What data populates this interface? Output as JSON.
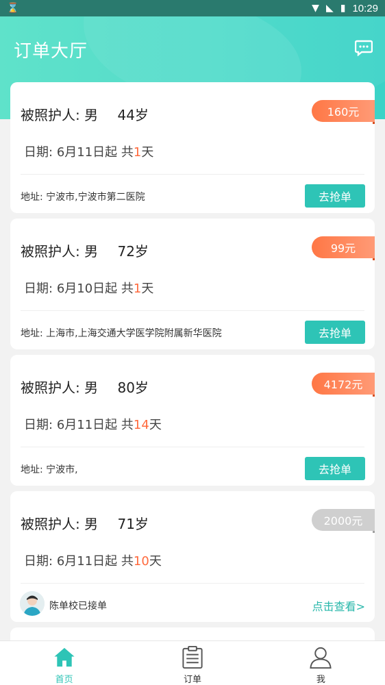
{
  "status_bar": {
    "time": "10:29"
  },
  "header": {
    "title": "订单大厅"
  },
  "orders": [
    {
      "patient_label": "被照护人:",
      "gender": "男",
      "age": "44岁",
      "price": "160元",
      "price_style": "orange",
      "date_label": "日期:",
      "date": "6月11日起",
      "total_prefix": "共",
      "days": "1",
      "days_unit": "天",
      "address": "地址:  宁波市,宁波市第二医院",
      "action": "去抢单"
    },
    {
      "patient_label": "被照护人:",
      "gender": "男",
      "age": "72岁",
      "price": "99元",
      "price_style": "orange",
      "date_label": "日期:",
      "date": "6月10日起",
      "total_prefix": "共",
      "days": "1",
      "days_unit": "天",
      "address": "地址:  上海市,上海交通大学医学院附属新华医院",
      "action": "去抢单"
    },
    {
      "patient_label": "被照护人:",
      "gender": "男",
      "age": "80岁",
      "price": "4172元",
      "price_style": "orange",
      "date_label": "日期:",
      "date": "6月11日起",
      "total_prefix": "共",
      "days": "14",
      "days_unit": "天",
      "address": "地址:  宁波市,",
      "action": "去抢单"
    },
    {
      "patient_label": "被照护人:",
      "gender": "男",
      "age": "71岁",
      "price": "2000元",
      "price_style": "gray",
      "date_label": "日期:",
      "date": "6月11日起",
      "total_prefix": "共",
      "days": "10",
      "days_unit": "天",
      "accepted_by": "陈单校已接单",
      "view_link": "点击查看>"
    }
  ],
  "tabs": [
    {
      "label": "首页",
      "icon": "home-icon",
      "active": true
    },
    {
      "label": "订单",
      "icon": "clipboard-icon",
      "active": false
    },
    {
      "label": "我",
      "icon": "user-icon",
      "active": false
    }
  ],
  "colors": {
    "accent": "#2ec4b6",
    "price_orange": "#ff7745",
    "days_orange": "#ff6a3d",
    "header_start": "#52e0c6",
    "header_end": "#3bd3c7"
  }
}
